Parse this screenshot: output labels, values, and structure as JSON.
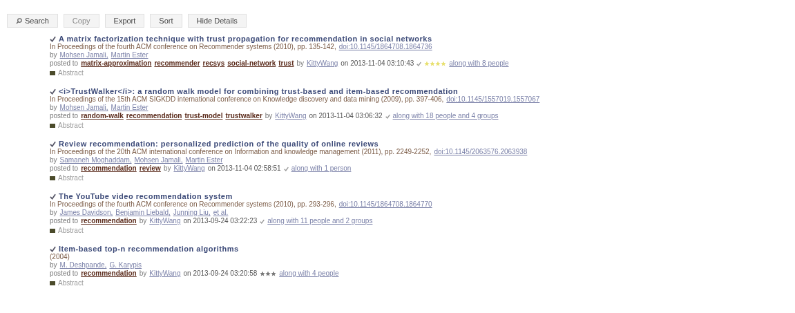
{
  "toolbar": [
    {
      "label": "Search",
      "kind": "search",
      "disabled": false
    },
    {
      "label": "Copy",
      "kind": "plain",
      "disabled": true
    },
    {
      "label": "Export",
      "kind": "plain",
      "disabled": false
    },
    {
      "label": "Sort",
      "kind": "plain",
      "disabled": false
    },
    {
      "label": "Hide Details",
      "kind": "plain",
      "disabled": false
    }
  ],
  "entries": [
    {
      "title": "A matrix factorization technique with trust propagation for recommendation in social networks",
      "venue": "In Proceedings of the fourth ACM conference on Recommender systems (2010), pp. 135-142,",
      "doi": "doi:10.1145/1864708.1864736",
      "by": "by",
      "authors": [
        "Mohsen Jamali,",
        "Martin Ester"
      ],
      "posted_to": "posted to",
      "tags": [
        "matrix-approximation",
        "recommender",
        "recsys",
        "social-network",
        "trust"
      ],
      "posted_by": "by",
      "user": "KittyWang",
      "date": "on 2013-11-04 03:10:43",
      "read": true,
      "stars": 4,
      "along": "along with 8 people",
      "abstract": "Abstract"
    },
    {
      "title": "<i>TrustWalker</i>: a random walk model for combining trust-based and item-based recommendation",
      "venue": "In Proceedings of the 15th ACM SIGKDD international conference on Knowledge discovery and data mining (2009), pp. 397-406,",
      "doi": "doi:10.1145/1557019.1557067",
      "by": "by",
      "authors": [
        "Mohsen Jamali,",
        "Martin Ester"
      ],
      "posted_to": "posted to",
      "tags": [
        "random-walk",
        "recommendation",
        "trust-model",
        "trustwalker"
      ],
      "posted_by": "by",
      "user": "KittyWang",
      "date": "on 2013-11-04 03:06:32",
      "read": true,
      "along": "along with 18 people and 4 groups",
      "abstract": "Abstract"
    },
    {
      "title": "Review recommendation: personalized prediction of the quality of online reviews",
      "venue": "In Proceedings of the 20th ACM international conference on Information and knowledge management (2011), pp. 2249-2252,",
      "doi": "doi:10.1145/2063576.2063938",
      "by": "by",
      "authors": [
        "Samaneh Moghaddam,",
        "Mohsen Jamali,",
        "Martin Ester"
      ],
      "posted_to": "posted to",
      "tags": [
        "recommendation",
        "review"
      ],
      "posted_by": "by",
      "user": "KittyWang",
      "date": "on 2013-11-04 02:58:51",
      "read": true,
      "along": "along with 1 person",
      "abstract": "Abstract"
    },
    {
      "title": "The YouTube video recommendation system",
      "venue": "In Proceedings of the fourth ACM conference on Recommender systems (2010), pp. 293-296,",
      "doi": "doi:10.1145/1864708.1864770",
      "by": "by",
      "authors": [
        "James Davidson,",
        "Benjamin Liebald,",
        "Junning Liu,",
        "et al."
      ],
      "posted_to": "posted to",
      "tags": [
        "recommendation"
      ],
      "posted_by": "by",
      "user": "KittyWang",
      "date": "on 2013-09-24 03:22:23",
      "read": true,
      "along": "along with 11 people and 2 groups",
      "abstract": "Abstract"
    },
    {
      "title": "Item-based top-n recommendation algorithms",
      "venue": "(2004)",
      "by": "by",
      "authors": [
        "M. Deshpande,",
        "G. Karypis"
      ],
      "posted_to": "posted to",
      "tags": [
        "recommendation"
      ],
      "posted_by": "by",
      "user": "KittyWang",
      "date": "on 2013-09-24 03:20:58",
      "read": false,
      "stars": 3,
      "along": "along with 4 people",
      "abstract": "Abstract"
    }
  ]
}
